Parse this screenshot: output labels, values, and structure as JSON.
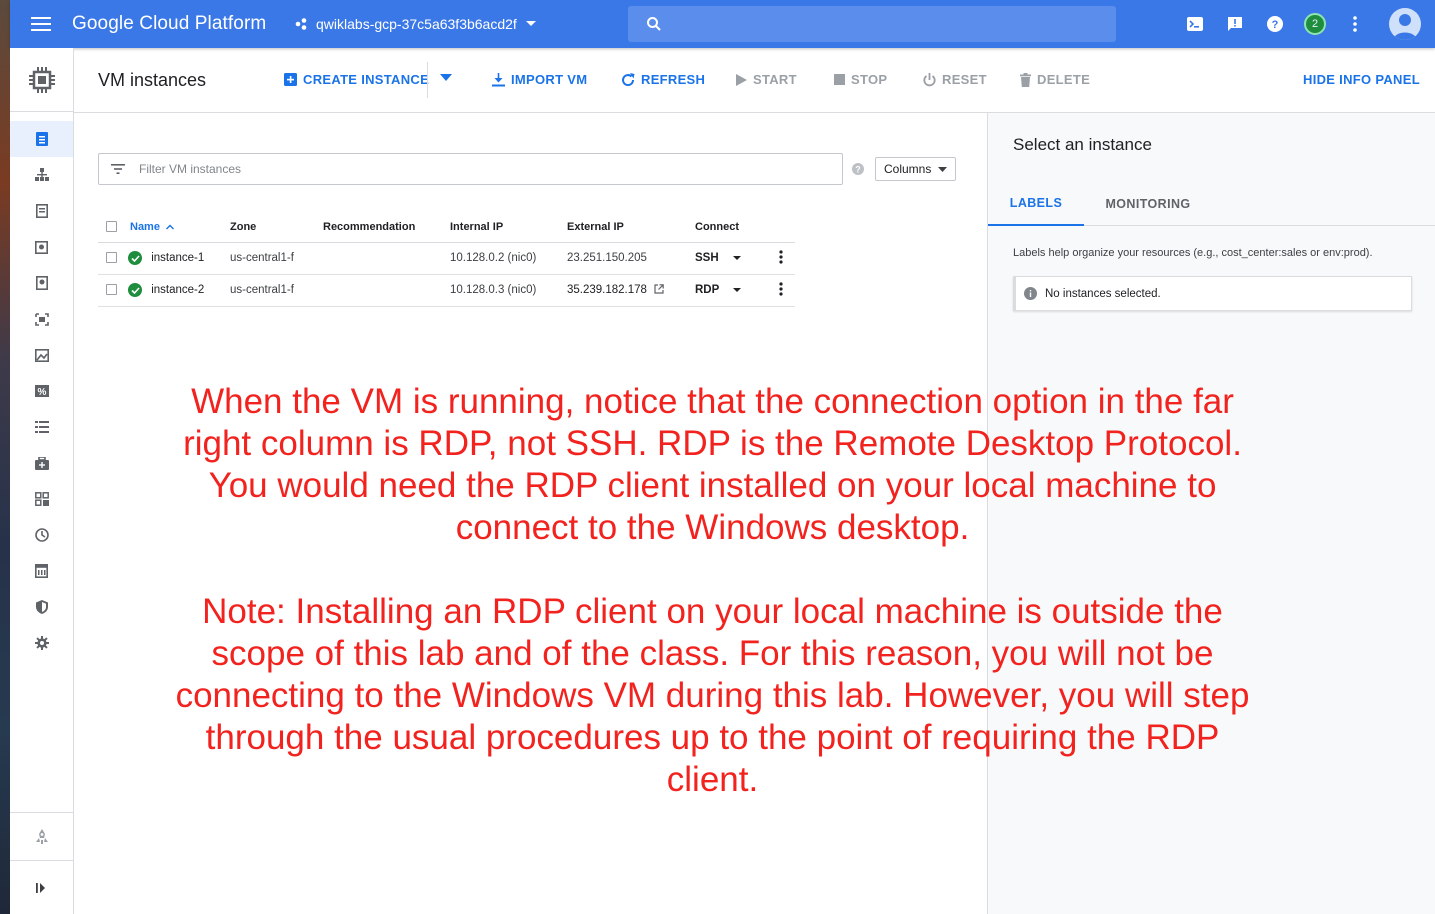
{
  "topbar": {
    "brand": "Google Cloud Platform",
    "project": "qwiklabs-gcp-37c5a63f3b6acd2f",
    "search_placeholder": "",
    "notification_count": "2",
    "bar_color": "#3b78e7"
  },
  "leftnav": {
    "items": [
      "document-icon",
      "network-icon",
      "template-icon",
      "disk-icon",
      "snapshot-icon",
      "image-icon",
      "tpu-icon",
      "commitments-icon",
      "metadata-icon",
      "health-check-icon",
      "zones-icon",
      "network-endpoint-icon",
      "operations-icon",
      "reports-icon",
      "security-scan-icon",
      "settings-icon"
    ],
    "active_index": 0
  },
  "actionbar": {
    "title": "VM instances",
    "create": "CREATE INSTANCE",
    "import": "IMPORT VM",
    "refresh": "REFRESH",
    "start": "START",
    "stop": "STOP",
    "reset": "RESET",
    "delete": "DELETE",
    "hide_panel": "HIDE INFO PANEL"
  },
  "filter": {
    "placeholder": "Filter VM instances",
    "columns_label": "Columns"
  },
  "table": {
    "headers": {
      "name": "Name",
      "zone": "Zone",
      "recommendation": "Recommendation",
      "internal_ip": "Internal IP",
      "external_ip": "External IP",
      "connect": "Connect"
    },
    "rows": [
      {
        "name": "instance-1",
        "zone": "us-central1-f",
        "recommendation": "",
        "internal_ip": "10.128.0.2 (nic0)",
        "external_ip": "23.251.150.205",
        "connect": "SSH"
      },
      {
        "name": "instance-2",
        "zone": "us-central1-f",
        "recommendation": "",
        "internal_ip": "10.128.0.3 (nic0)",
        "external_ip": "35.239.182.178",
        "connect": "RDP"
      }
    ]
  },
  "infopanel": {
    "title": "Select an instance",
    "tab_labels": "LABELS",
    "tab_monitoring": "MONITORING",
    "description": "Labels help organize your resources (e.g., cost_center:sales or env:prod).",
    "empty_message": "No instances selected."
  },
  "annotation": {
    "paragraph1": "When the VM is running, notice that the connection option in the far right column is RDP, not SSH. RDP is the Remote Desktop Protocol. You would need the RDP client installed on your local machine to connect to the Windows desktop.",
    "paragraph2": "Note: Installing an RDP client on your local machine is outside the scope of this lab and of the class. For this reason, you will not be connecting to the Windows VM during this lab. However, you will step through the usual procedures up to the point of requiring the RDP client.",
    "color": "#f2221e"
  }
}
